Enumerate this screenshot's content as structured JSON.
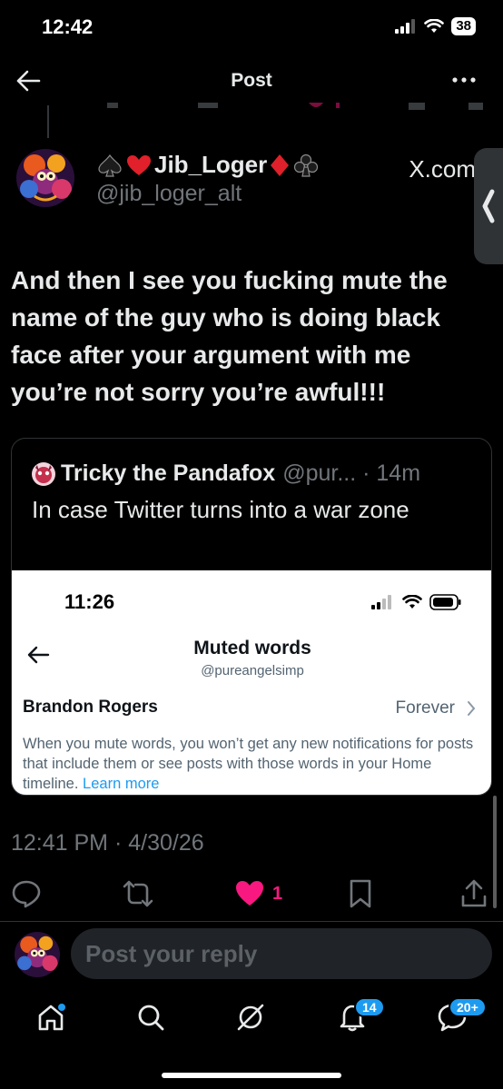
{
  "status_bar": {
    "time": "12:42",
    "battery": "38"
  },
  "nav": {
    "title": "Post"
  },
  "post": {
    "display_name": "Jib_Loger",
    "handle": "@jib_loger_alt",
    "link_domain": "X.com",
    "text": "And then I see you fucking mute the name of the guy who is doing black face after your argument with me you’re not sorry you’re awful!!!",
    "timestamp": "12:41 PM · 4/30/26",
    "like_count": "1"
  },
  "quote": {
    "name": "Tricky the Pandafox",
    "meta": "@pur... · 14m",
    "text": "In case Twitter turns into a war zone",
    "embedded": {
      "time": "11:26",
      "title": "Muted words",
      "handle": "@pureangelsimp",
      "row_label": "Brandon Rogers",
      "row_value": "Forever",
      "description": "When you mute words, you won’t get any new notifications for posts that include them or see posts with those words in your Home timeline.",
      "link_text": "Learn more"
    }
  },
  "reply": {
    "placeholder": "Post your reply"
  },
  "tab_bar": {
    "notifications_badge": "14",
    "messages_badge": "20+"
  },
  "colors": {
    "like": "#f91880",
    "accent": "#1d9bf0",
    "muted": "#71767b",
    "background": "#000000"
  }
}
